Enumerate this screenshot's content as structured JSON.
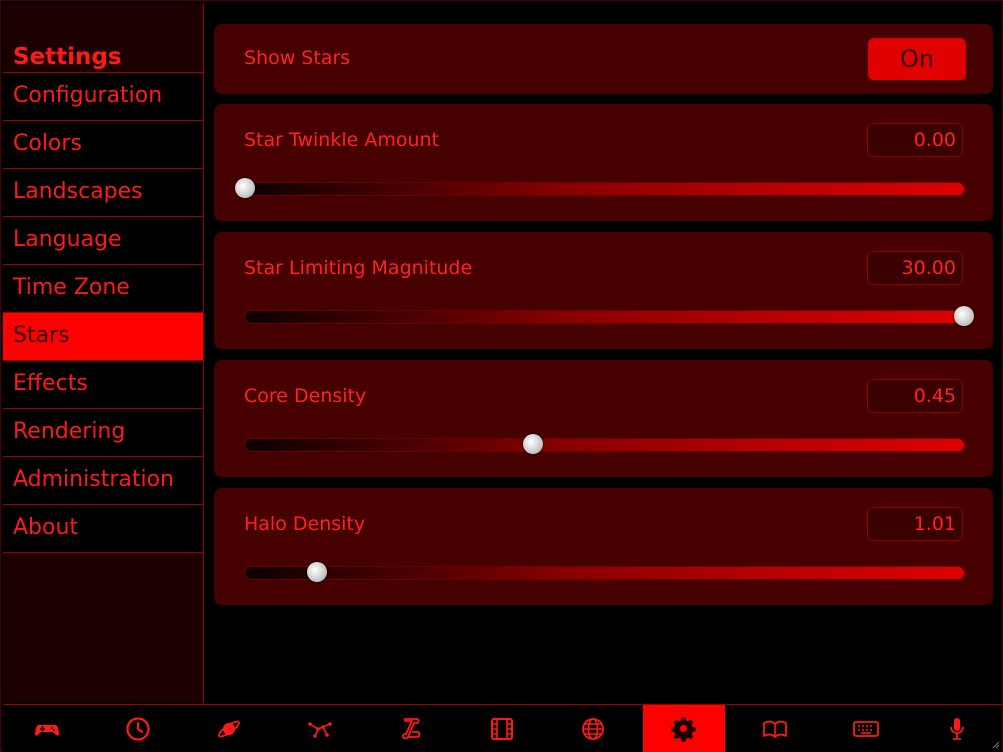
{
  "sidebar": {
    "title": "Settings",
    "items": [
      {
        "label": "Configuration",
        "active": false
      },
      {
        "label": "Colors",
        "active": false
      },
      {
        "label": "Landscapes",
        "active": false
      },
      {
        "label": "Language",
        "active": false
      },
      {
        "label": "Time Zone",
        "active": false
      },
      {
        "label": "Stars",
        "active": true
      },
      {
        "label": "Effects",
        "active": false
      },
      {
        "label": "Rendering",
        "active": false
      },
      {
        "label": "Administration",
        "active": false
      },
      {
        "label": "About",
        "active": false
      }
    ]
  },
  "show_stars": {
    "label": "Show Stars",
    "toggle": "On"
  },
  "sliders": [
    {
      "label": "Star Twinkle Amount",
      "value": "0.00",
      "fraction": 0.0
    },
    {
      "label": "Star Limiting Magnitude",
      "value": "30.00",
      "fraction": 1.0
    },
    {
      "label": "Core Density",
      "value": "0.45",
      "fraction": 0.4
    },
    {
      "label": "Halo Density",
      "value": "1.01",
      "fraction": 0.1
    }
  ],
  "bottombar": {
    "icons": [
      "gamepad-icon",
      "clock-icon",
      "planet-icon",
      "constellation-icon",
      "scroll-icon",
      "film-icon",
      "globe-icon",
      "gear-icon",
      "book-icon",
      "keyboard-icon",
      "microphone-icon"
    ],
    "active": "gear-icon"
  },
  "colors": {
    "accent": "#ff0000",
    "panel": "#470000",
    "text": "#ff1a1a"
  }
}
